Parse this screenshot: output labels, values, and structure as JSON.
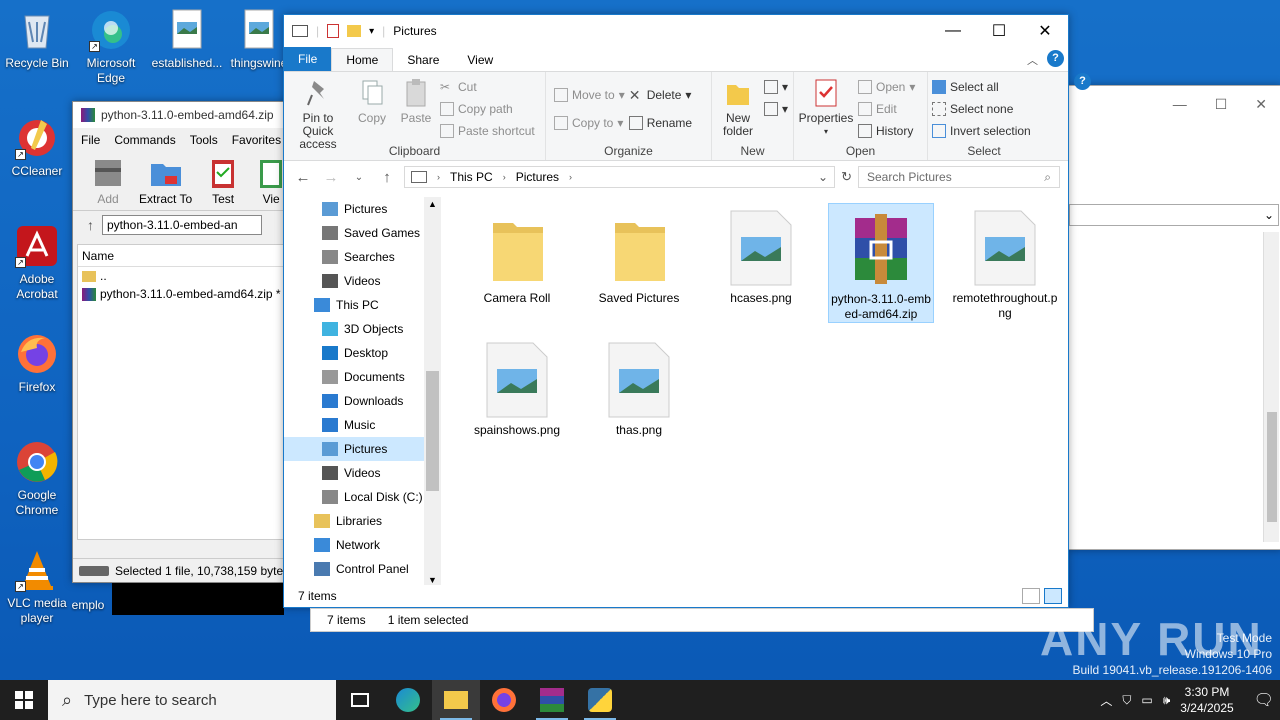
{
  "desktop": {
    "icons": [
      {
        "label": "Recycle Bin",
        "icon": "recycle-bin-icon"
      },
      {
        "label": "Microsoft Edge",
        "icon": "edge-icon"
      },
      {
        "label": "established...",
        "icon": "image-file-icon"
      },
      {
        "label": "thingswine",
        "icon": "image-file-icon"
      },
      {
        "label": "CCleaner",
        "icon": "ccleaner-icon"
      },
      {
        "label": "Adobe Acrobat",
        "icon": "acrobat-icon"
      },
      {
        "label": "Firefox",
        "icon": "firefox-icon"
      },
      {
        "label": "Google Chrome",
        "icon": "chrome-icon"
      },
      {
        "label": "VLC media player",
        "icon": "vlc-icon"
      },
      {
        "label": "emplo",
        "icon": "file-icon"
      }
    ]
  },
  "winrar": {
    "title": "python-3.11.0-embed-amd64.zip",
    "menu": [
      "File",
      "Commands",
      "Tools",
      "Favorites"
    ],
    "tools": [
      "Add",
      "Extract To",
      "Test",
      "Vie"
    ],
    "path": "python-3.11.0-embed-an",
    "col_name": "Name",
    "rows": [
      "..",
      "python-3.11.0-embed-amd64.zip *"
    ],
    "status": "Selected 1 file, 10,738,159 bytes"
  },
  "explorer": {
    "title": "Pictures",
    "tabs": {
      "file": "File",
      "home": "Home",
      "share": "Share",
      "view": "View"
    },
    "ribbon": {
      "clipboard": {
        "label": "Clipboard",
        "pin": "Pin to Quick access",
        "copy": "Copy",
        "paste": "Paste",
        "cut": "Cut",
        "copy_path": "Copy path",
        "paste_shortcut": "Paste shortcut"
      },
      "organize": {
        "label": "Organize",
        "move_to": "Move to",
        "copy_to": "Copy to",
        "delete": "Delete",
        "rename": "Rename"
      },
      "new": {
        "label": "New",
        "new_folder": "New folder"
      },
      "open": {
        "label": "Open",
        "properties": "Properties",
        "open": "Open",
        "edit": "Edit",
        "history": "History"
      },
      "select": {
        "label": "Select",
        "select_all": "Select all",
        "select_none": "Select none",
        "invert": "Invert selection"
      }
    },
    "address": {
      "crumbs": [
        "This PC",
        "Pictures"
      ],
      "search_placeholder": "Search Pictures"
    },
    "nav": [
      {
        "label": "Pictures",
        "icon": "pictures-icon",
        "indent": 2
      },
      {
        "label": "Saved Games",
        "icon": "saved-games-icon",
        "indent": 2
      },
      {
        "label": "Searches",
        "icon": "search-icon",
        "indent": 2
      },
      {
        "label": "Videos",
        "icon": "videos-icon",
        "indent": 2
      },
      {
        "label": "This PC",
        "icon": "this-pc-icon",
        "indent": 1
      },
      {
        "label": "3D Objects",
        "icon": "3d-objects-icon",
        "indent": 2
      },
      {
        "label": "Desktop",
        "icon": "desktop-icon",
        "indent": 2
      },
      {
        "label": "Documents",
        "icon": "documents-icon",
        "indent": 2
      },
      {
        "label": "Downloads",
        "icon": "downloads-icon",
        "indent": 2
      },
      {
        "label": "Music",
        "icon": "music-icon",
        "indent": 2
      },
      {
        "label": "Pictures",
        "icon": "pictures-icon",
        "indent": 2,
        "selected": true
      },
      {
        "label": "Videos",
        "icon": "videos-icon",
        "indent": 2
      },
      {
        "label": "Local Disk (C:)",
        "icon": "disk-icon",
        "indent": 2
      },
      {
        "label": "Libraries",
        "icon": "libraries-icon",
        "indent": 1
      },
      {
        "label": "Network",
        "icon": "network-icon",
        "indent": 1
      },
      {
        "label": "Control Panel",
        "icon": "control-panel-icon",
        "indent": 1
      }
    ],
    "files": [
      {
        "name": "Camera Roll",
        "type": "folder"
      },
      {
        "name": "Saved Pictures",
        "type": "folder"
      },
      {
        "name": "hcases.png",
        "type": "image"
      },
      {
        "name": "python-3.11.0-embed-amd64.zip",
        "type": "archive",
        "selected": true
      },
      {
        "name": "remotethroughout.png",
        "type": "image"
      },
      {
        "name": "spainshows.png",
        "type": "image"
      },
      {
        "name": "thas.png",
        "type": "image"
      }
    ],
    "status": {
      "count": "7 items",
      "count2": "7 items",
      "selected": "1 item selected"
    }
  },
  "taskbar": {
    "search_placeholder": "Type here to search",
    "time": "3:30 PM",
    "date": "3/24/2025"
  },
  "watermark": {
    "line1": "Test Mode",
    "line2": "Windows 10 Pro",
    "line3": "Build 19041.vb_release.191206-1406",
    "brand": "ANY RUN"
  },
  "colors": {
    "accent": "#1979ca",
    "selection": "#cce8ff",
    "desktop": "#1670c9"
  }
}
